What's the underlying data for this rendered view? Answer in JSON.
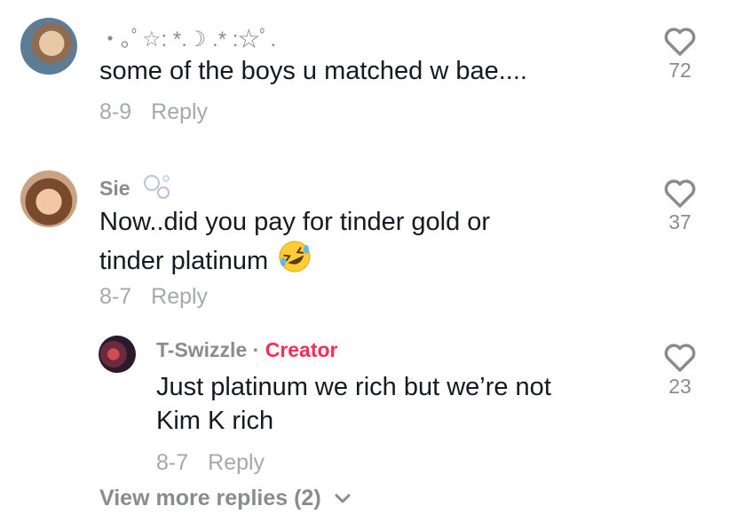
{
  "comments": [
    {
      "username": "・｡ﾟ☆: *.☽ .* :☆ﾟ.",
      "text": "some of the boys u matched w bae....",
      "date": "8-9",
      "reply_label": "Reply",
      "likes": "72",
      "icon": "heart-outline-icon"
    },
    {
      "username": "Sie",
      "username_decoration": "bubbles-icon",
      "text_line1": "Now..did you pay for tinder gold or",
      "text_line2": "tinder platinum",
      "emoji": "rolling-on-floor-laughing-emoji",
      "date": "8-7",
      "reply_label": "Reply",
      "likes": "37",
      "icon": "heart-outline-icon"
    }
  ],
  "reply": {
    "username": "T-Swizzle",
    "separator": "·",
    "badge": "Creator",
    "text_line1": "Just platinum we rich but we’re not",
    "text_line2": "Kim K rich",
    "date": "8-7",
    "reply_label": "Reply",
    "likes": "23",
    "icon": "heart-outline-icon"
  },
  "view_more": {
    "label": "View more replies (2)",
    "icon": "chevron-down-icon"
  },
  "colors": {
    "text": "#161823",
    "secondary": "#8a8b91",
    "meta": "#a7a8ad",
    "creator": "#fe2c55"
  }
}
